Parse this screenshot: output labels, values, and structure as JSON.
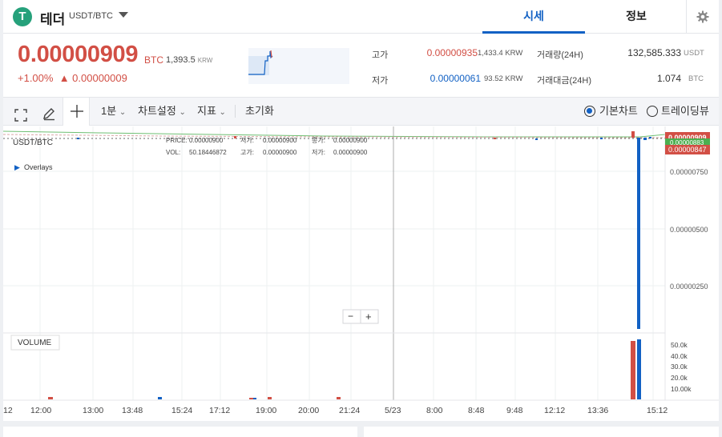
{
  "header": {
    "logo_glyph": "T",
    "coin_name": "테더",
    "pair": "USDT/BTC",
    "tabs": [
      "시세",
      "정보"
    ]
  },
  "ticker": {
    "price": "0.00000909",
    "price_unit": "BTC",
    "price_krw": "1,393.5",
    "krw_unit": "KRW",
    "change_pct": "+1.00%",
    "change_abs": "▲ 0.00000009"
  },
  "stats": {
    "high_label": "고가",
    "high": "0.00000935",
    "high_krw": "1,433.4 KRW",
    "low_label": "저가",
    "low": "0.00000061",
    "low_krw": "93.52 KRW",
    "volume_label": "거래량(24H)",
    "volume": "132,585.333",
    "volume_unit": "USDT",
    "turnover_label": "거래대금(24H)",
    "turnover": "1.074",
    "turnover_unit": "BTC"
  },
  "toolbar": {
    "interval": "1분",
    "chart_settings": "차트설정",
    "indicators": "지표",
    "reset": "초기화",
    "basic_chart": "기본차트",
    "tradingview": "트레이딩뷰"
  },
  "overlay": {
    "symbol": "USDT/BTC",
    "overlays": "Overlays",
    "price_label": "PRICE:",
    "price_val": "0.00000900",
    "low_label": "저가:",
    "low_val": "0.00000900",
    "close_label": "종가:",
    "close_val": "0.00000900",
    "vol_label": "VOL:",
    "vol_val": "50.18446872",
    "high_label": "고가:",
    "high_val": "0.00000900",
    "low2_label": "저가:",
    "low2_val": "0.00000900",
    "volume_title": "VOLUME",
    "zoom_out": "−",
    "zoom_in": "+"
  },
  "axis": {
    "price_ticks": [
      "0.00000750",
      "0.00000500",
      "0.00000250"
    ],
    "current_tag": "0.00000909",
    "mid_tag": "0.00000883",
    "low_tag": "0.00000847",
    "volume_ticks": [
      "50.0k",
      "40.0k",
      "30.0k",
      "20.0k",
      "10.00k"
    ],
    "time_ticks": [
      "12",
      "12:00",
      "13:00",
      "13:48",
      "15:24",
      "17:12",
      "19:00",
      "20:00",
      "21:24",
      "5/23",
      "8:00",
      "8:48",
      "9:48",
      "12:12",
      "13:36",
      "15:12"
    ]
  },
  "colors": {
    "up": "#d24f45",
    "down": "#1261c4",
    "accent": "#1261c4",
    "tether": "#26a17b"
  }
}
